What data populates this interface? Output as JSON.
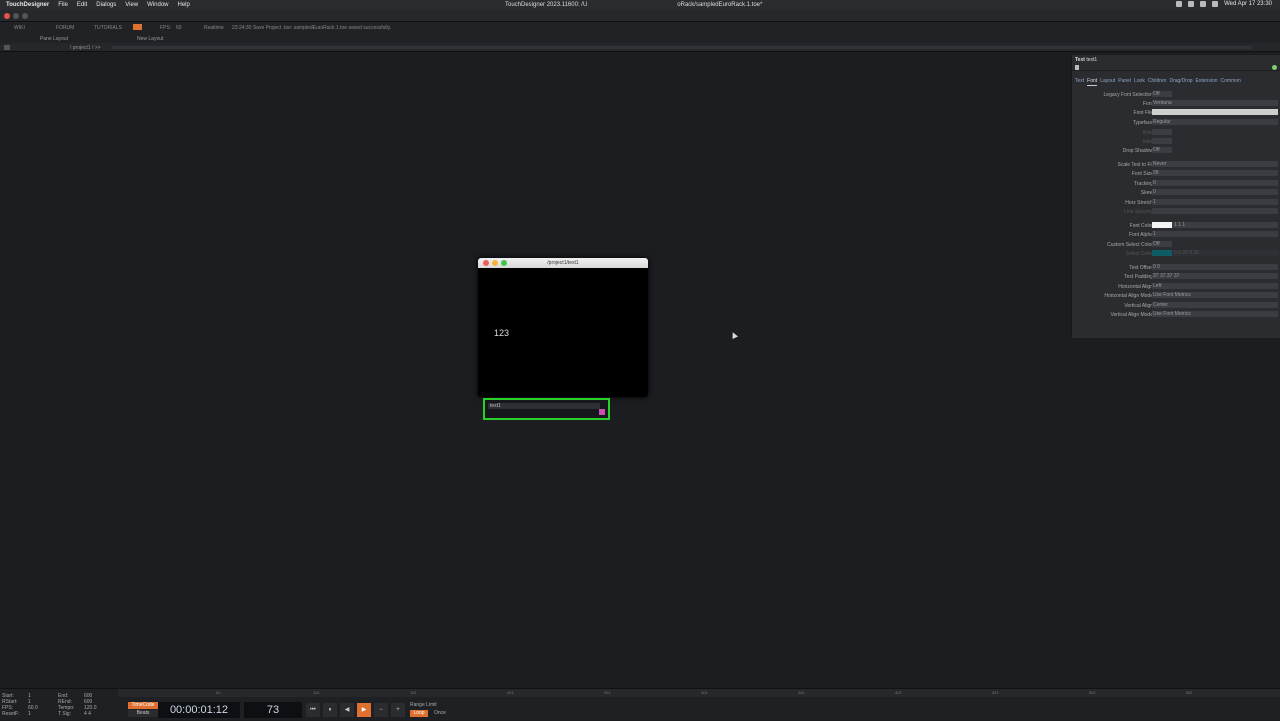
{
  "menubar": {
    "app": "TouchDesigner",
    "items": [
      "File",
      "Edit",
      "Dialogs",
      "View",
      "Window",
      "Help"
    ],
    "window_title": "TouchDesigner 2023.11600: /U",
    "window_title_right": "oRack/sampledEuroRack.1.toe*",
    "clock": "Wed Apr 17  23:30"
  },
  "topstrip": {
    "wiki": "WIKI",
    "forum": "FORUM",
    "tutorials": "TUTORIALS",
    "fps_label": "FPS:",
    "fps_value": "60",
    "realtime": "Realtime",
    "status": "23:24:30 Save Project .toe: sampledEuroRack.1.toe saved successfully."
  },
  "panebar": {
    "pane_layout": "Pane Layout",
    "new_layout": "New Layout"
  },
  "pathbar": {
    "path": "/ project1 / >>"
  },
  "viewer": {
    "title": "/project1/text1",
    "content": "123"
  },
  "node": {
    "name": "text1"
  },
  "params": {
    "op_type": "Text",
    "op_name": "text1",
    "tabs": [
      "Text",
      "Font",
      "Layout",
      "Panel",
      "Look",
      "Children",
      "Drag/Drop",
      "Extension",
      "Common"
    ],
    "active_tab": "Font",
    "rows": [
      {
        "label": "Legacy Font Selection",
        "value": "Off"
      },
      {
        "label": "Font",
        "value": "Verdana"
      },
      {
        "label": "Font File",
        "value": ""
      },
      {
        "label": "Typeface",
        "value": "Regular"
      },
      {
        "label": "Bold",
        "value": ""
      },
      {
        "label": "Italic",
        "value": ""
      },
      {
        "label": "Drop Shadow",
        "value": "Off"
      },
      {
        "label": "Scale Text to Fit",
        "value": "Never"
      },
      {
        "label": "Font Size",
        "value": "28"
      },
      {
        "label": "Tracking",
        "value": "0"
      },
      {
        "label": "Skew",
        "value": "0"
      },
      {
        "label": "Horz Stretch",
        "value": "1"
      },
      {
        "label": "Line Spacing",
        "value": ""
      },
      {
        "label": "Font Color",
        "value": "1     1     1"
      },
      {
        "label": "Font Alpha",
        "value": "1"
      },
      {
        "label": "Custom Select Color",
        "value": "Off"
      },
      {
        "label": "Select Color",
        "value": "0     0.25     0.35"
      },
      {
        "label": "Text Offset",
        "value": "0     0"
      },
      {
        "label": "Text Padding",
        "value": "37     37     37     37"
      },
      {
        "label": "Horizontal Align",
        "value": "Left"
      },
      {
        "label": "Horizontal Align Mode",
        "value": "Use Font Metrics"
      },
      {
        "label": "Vertical Align",
        "value": "Center"
      },
      {
        "label": "Vertical Align Mode",
        "value": "Use Font Metrics"
      }
    ]
  },
  "timeline": {
    "ticks": [
      "51",
      "101",
      "151",
      "201",
      "251",
      "301",
      "351",
      "401",
      "451",
      "501",
      "551"
    ]
  },
  "stats": {
    "start": "Start:",
    "start_v": "1",
    "end": "End:",
    "end_v": "600",
    "rstart": "RStart:",
    "rstart_v": "1",
    "rend": "REnd:",
    "rend_v": "600",
    "fps": "FPS:",
    "fps_v": "60.0",
    "tempo": "Tempo:",
    "tempo_v": "120.0",
    "resetf": "ResetF:",
    "resetf_v": "1",
    "tsig": "T Sig:",
    "tsig_v": "4    4"
  },
  "transport": {
    "timecode_btn": "TimeCode",
    "beats_btn": "Beats",
    "timecode": "00:00:01:12",
    "frame": "73",
    "range_limit": "Range Limit",
    "loop": "Loop",
    "once": "Once"
  },
  "colors": {
    "accent": "#e07030",
    "node_border": "#2ad02a",
    "flag": "#c84fb0"
  }
}
